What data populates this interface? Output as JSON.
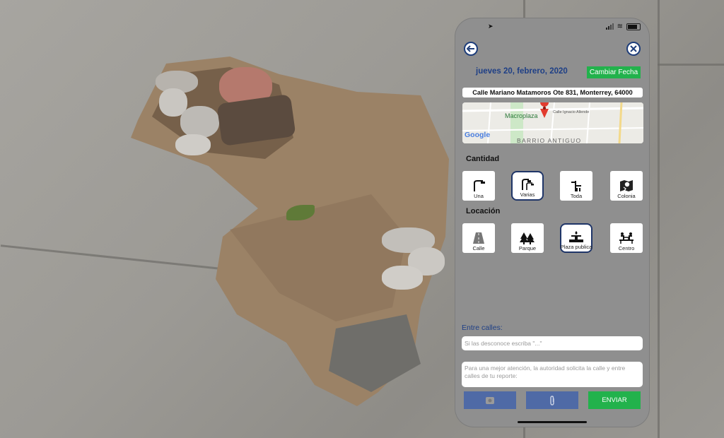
{
  "colors": {
    "accent_blue": "#1e3f86",
    "green": "#22b24c",
    "blue_button": "#4f6aa6"
  },
  "header": {
    "back_icon": "back-arrow-icon",
    "close_icon": "close-x-icon",
    "date": "jueves 20, febrero, 2020",
    "change_date_label": "Cambiar Fecha"
  },
  "address": "Calle Mariano Matamoros Ote 831, Monterrey, 64000",
  "map": {
    "poi": "Macroplaza",
    "street": "Calle Ignacio Allende",
    "district": "BARRIO ANTIGUO",
    "logo": "Google"
  },
  "cantidad": {
    "title": "Cantidad",
    "options": [
      {
        "label": "Una",
        "icon": "single-lamp-icon",
        "selected": false
      },
      {
        "label": "Varias",
        "icon": "multiple-lamps-icon",
        "selected": true
      },
      {
        "label": "Toda",
        "icon": "street-sign-icon",
        "selected": false
      },
      {
        "label": "Colonia",
        "icon": "map-pin-icon",
        "selected": false
      }
    ]
  },
  "locacion": {
    "title": "Locación",
    "options": [
      {
        "label": "Calle",
        "icon": "street-icon",
        "selected": false
      },
      {
        "label": "Parque",
        "icon": "trees-icon",
        "selected": false
      },
      {
        "label": "Plaza publica",
        "icon": "fountain-icon",
        "selected": true
      },
      {
        "label": "Centro",
        "icon": "bench-people-icon",
        "selected": false
      }
    ]
  },
  "entre_calles": {
    "label": "Entre calles:",
    "placeholder": "Si las desconoce escriba \"...\""
  },
  "note_placeholder": "Para una mejor atención, la autoridad solicita la calle y entre calles de tu reporte:",
  "buttons": {
    "photo_icon": "photo-icon",
    "attach_icon": "paperclip-icon",
    "send_label": "ENVIAR"
  }
}
